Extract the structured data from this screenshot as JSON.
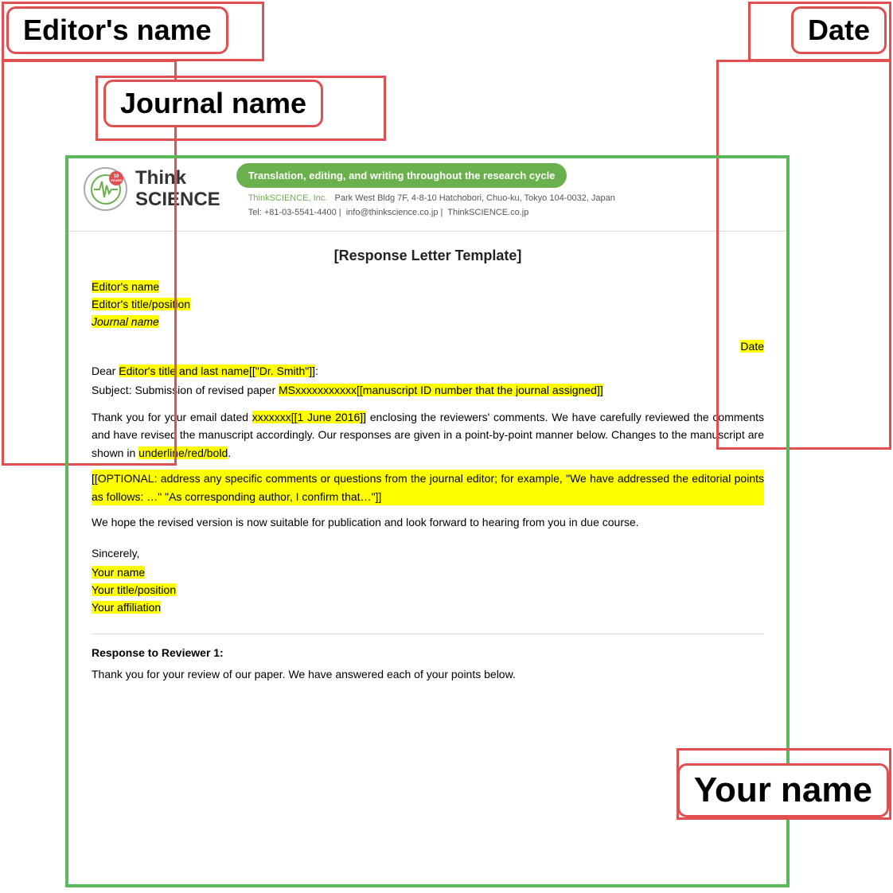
{
  "annotations": {
    "editors_name_label": "Editor's name",
    "journal_name_label": "Journal name",
    "your_name_label": "Your name",
    "date_label": "Date"
  },
  "header": {
    "logo_years_line1": "10",
    "logo_years_line2": "YEARS",
    "logo_name_line1": "Think",
    "logo_name_line2": "SCIENCE",
    "tagline": "Translation, editing, and writing throughout the research cycle",
    "contact_name": "ThinkSCIENCE, Inc.",
    "contact_address": "Park West Bldg 7F, 4-8-10 Hatchobori, Chuo-ku, Tokyo 104-0032, Japan",
    "contact_tel": "Tel: +81-03-5541-4400",
    "contact_email": "info@thinkscience.co.jp",
    "contact_website": "ThinkSCIENCE.co.jp"
  },
  "document": {
    "title": "[Response Letter Template]",
    "editor_name_field": "Editor's name",
    "editor_title_field": "Editor's title/position",
    "journal_name_field": "Journal name",
    "date_field": "Date",
    "dear_line": "Dear Editor's title and last name[[\"Dr. Smith\"]]:",
    "subject_prefix": "Subject:  Submission of revised paper  ",
    "subject_highlight": "MSxxxxxxxxxxx[[manuscript ID number that the journal assigned]]",
    "body1_prefix": "Thank you for your email dated ",
    "body1_date": "xxxxxxx[[1 June 2016]]",
    "body1_rest": " enclosing the reviewers' comments. We have carefully reviewed the comments and have revised the manuscript accordingly. Our responses are given in a point-by-point manner below. Changes to the manuscript are shown in ",
    "body1_highlight": "underline/red/bold",
    "body1_end": ".",
    "optional_text": "[[OPTIONAL: address any specific comments or questions from the journal editor; for example, \"We have addressed the editorial points as follows: …\" \"As corresponding author, I confirm that…\"]]",
    "body2": "We hope the revised version is now suitable for publication and look forward to hearing from you in due course.",
    "sincerely": "Sincerely,",
    "your_name_field": "Your name",
    "your_title_field": "Your title/position",
    "your_affiliation_field": "Your affiliation",
    "reviewer_heading": "Response to Reviewer 1:",
    "reviewer_text": "Thank you for your review of our paper. We have answered each of your points below."
  }
}
